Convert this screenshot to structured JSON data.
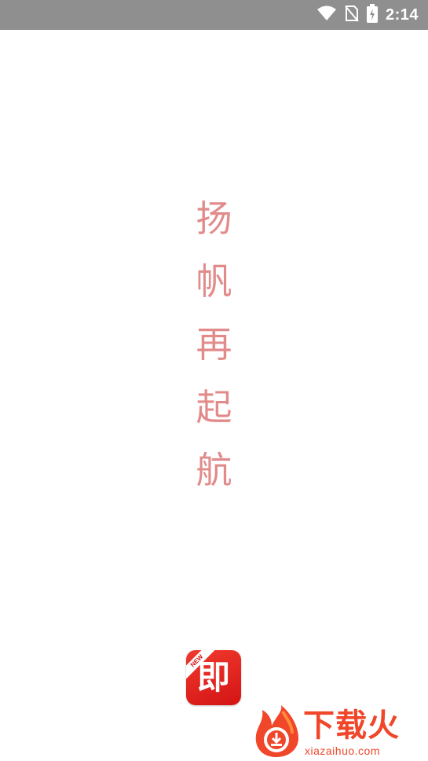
{
  "status_bar": {
    "time": "2:14",
    "icons": [
      "wifi-icon",
      "no-sim-icon",
      "battery-charging-icon"
    ]
  },
  "splash": {
    "slogan": [
      "扬",
      "帆",
      "再",
      "起",
      "航"
    ]
  },
  "app_logo": {
    "character": "即",
    "badge": "NEW",
    "colors": {
      "background": "#e32219",
      "foreground": "#ffffff"
    }
  },
  "watermark": {
    "title": "下载火",
    "url": "xiazaihuo.com",
    "color": "#f0462a"
  },
  "colors": {
    "status_bar": "#8f8f8f",
    "slogan": "#e28b8b",
    "background": "#ffffff"
  }
}
